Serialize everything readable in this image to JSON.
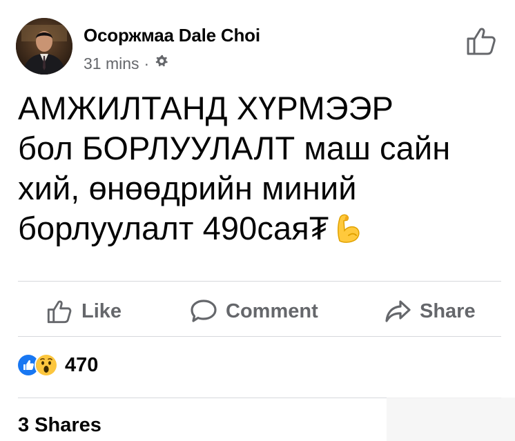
{
  "post": {
    "author": "Осоржмаа Dale Choi",
    "time": "31 mins",
    "separator": "·",
    "privacy_icon": "gear-icon",
    "text_lines": [
      "АМЖИЛТАНД ХҮРМЭЭР",
      "бол БОРЛУУЛАЛТ маш сайн",
      "хий, өнөөдрийн миний",
      "борлуулалт 490сая₮"
    ],
    "emoji": "flexed-biceps-emoji"
  },
  "actions": {
    "like_label": "Like",
    "comment_label": "Comment",
    "share_label": "Share"
  },
  "reactions": {
    "icons": [
      "like-reaction-icon",
      "wow-reaction-icon"
    ],
    "count": "470"
  },
  "shares": {
    "label": "3 Shares"
  },
  "colors": {
    "text": "#050505",
    "secondary": "#65676b",
    "like_blue": "#1877f2",
    "divider": "#d6d8dc"
  }
}
